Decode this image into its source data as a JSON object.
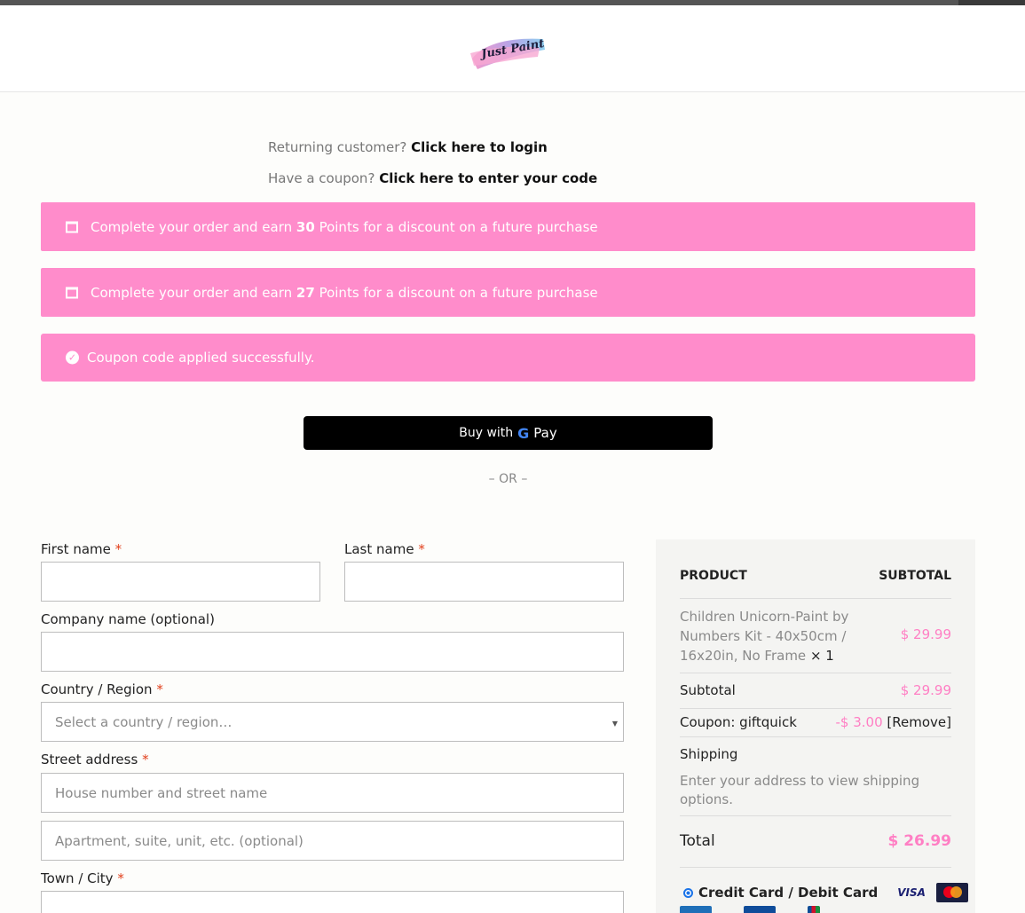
{
  "header": {
    "logo_text": "Just Paint"
  },
  "login": {
    "prompt": "Returning customer?",
    "link": "Click here to login"
  },
  "coupon": {
    "prompt": "Have a coupon?",
    "link": "Click here to enter your code"
  },
  "notices": [
    {
      "pre": "Complete your order and earn",
      "points": "30",
      "post": "Points for a discount on a future purchase"
    },
    {
      "pre": "Complete your order and earn",
      "points": "27",
      "post": "Points for a discount on a future purchase"
    }
  ],
  "success": {
    "text": "Coupon code applied successfully."
  },
  "gpay": {
    "label": "Buy with",
    "g": "G",
    "pay": "Pay"
  },
  "or_text": "– OR –",
  "form": {
    "first_name": "First name",
    "last_name": "Last name",
    "company": "Company name (optional)",
    "country": "Country / Region",
    "country_placeholder": "Select a country / region…",
    "street": "Street address",
    "street_placeholder": "House number and street name",
    "apt_placeholder": "Apartment, suite, unit, etc. (optional)",
    "town": "Town / City",
    "required_mark": "*"
  },
  "summary": {
    "col_product": "PRODUCT",
    "col_subtotal": "SUBTOTAL",
    "product_name": "Children Unicorn-Paint by Numbers Kit - 40x50cm / 16x20in, No Frame",
    "product_qty": "× 1",
    "product_price": "$ 29.99",
    "subtotal_label": "Subtotal",
    "subtotal_value": "$ 29.99",
    "coupon_label": "Coupon: giftquick",
    "coupon_value": "-$ 3.00",
    "coupon_remove": "[Remove]",
    "shipping_label": "Shipping",
    "shipping_note": "Enter your address to view shipping options.",
    "total_label": "Total",
    "total_value": "$ 26.99",
    "payment_method": "Credit Card / Debit Card",
    "visa": "VISA"
  },
  "colors": {
    "accent_pink": "#ff8ccb",
    "price_pink": "#ff7fc4",
    "required_red": "#e2401c"
  }
}
